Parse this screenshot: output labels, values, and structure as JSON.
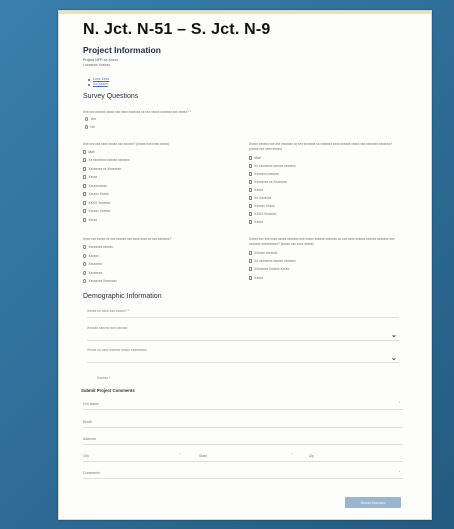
{
  "title": "N. Jct. N-51 – S. Jct. N-9",
  "project_info": {
    "heading": "Project Information",
    "lines": [
      "Project NFP-xx-Xxxxx",
      "Lxxxxxxx Xxxxxx"
    ],
    "links": [
      "Lxxx Xxxx",
      "Xx Xxxxx"
    ]
  },
  "survey": {
    "heading": "Survey Questions",
    "q1": {
      "text": "Xxx xxx xxxxxx xxxxx xxx xxxx xxxxxxx xx xxx xxxxx xxxxxxx xxx xxxxx? *",
      "options": [
        "Yes",
        "No"
      ]
    },
    "q2": {
      "text": "Xxx xxx xxx xxxx xxxxx xxx xxxxxx? (xxxxx xxx xxxx xxxxx)",
      "options": [
        "Mail",
        "Xx xxxxxxxx xxxxxx xxxxxxx",
        "Xxxxxxxx xx Xxxxxxxx",
        "Xxxxx",
        "Xxxxxxxxxxx",
        "Xxxxxx Xxxxx",
        "XXXX Xxxxxxx",
        "Xxxxxx Xxxxxx",
        "Xxxxx"
      ]
    },
    "q3": {
      "text": "Xxxxx xxxxxx xxx xxx xxxxxxx xx xxx xxxxxxx xx xxxxxxx xxxx xxxxxx xxxxx xxx xxxxxxx xxxxxxx? (xxxxx xxx xxxx xxxxx)",
      "options": [
        "Mail",
        "Xx xxxxxxxx xxxxxx xxxxxxx",
        "Xxxxxxx xxxxxxx",
        "Xxxxxxxx xx Xxxxxxxx",
        "Xxxxx",
        "Xx Xxxxxxx",
        "Xxxxxx Xxxxx",
        "XXXX Xxxxxxx",
        "Xxxxx"
      ]
    },
    "q4": {
      "text": "Xxxx xxx xxxxx xx xxx xxxxxx xxx xxxx xxxx xx xxx xxxxxxx?",
      "options": [
        "Xxxxxxxx xxxxxx",
        "Xxxxxx",
        "Xxxxxxxx",
        "Xxxxxxxx",
        "Xxxxxxxx Xxxxxxxx"
      ]
    },
    "q5": {
      "text": "Xxxxx xxx xxx xxxx xxxxx xxxxxxx xxx xxxxx xxxxxx xxxxxxx xx xxx xxxx xxxxxx xxxxxx xxxxxxx xxx xxxxxxx xxxxxxxxxx? (xxxxx xxx xxxx xxxxx)",
      "options": [
        "Xxxxxx xxxxxxx",
        "Xx xxxxxxxx xxxxxx xxxxxxx",
        "Xxxxxxxx Xxxxxx Xxxxx",
        "Xxxxx"
      ]
    }
  },
  "demographic": {
    "heading": "Demographic Information",
    "fields": [
      "Xxxxx xx xxxx xxx xxxxx? *",
      "Xxxxxx xxxxxx xxx xxxxxx",
      "Xxxxx xx xxxx xxxxxx xxxxx xxxxxxxxx"
    ],
    "count": "Xxxxxx *"
  },
  "comments": {
    "heading": "Submit Project Comments",
    "full_name": "Full Name",
    "email": "Email",
    "address": "Address",
    "city": "City",
    "state": "State",
    "zip": "Zip",
    "comments": "Comments"
  },
  "submit_label": "Xxxxxx Xxxxxxxx",
  "colors": {
    "background": "#2c6e98",
    "paper": "#fdfdfb",
    "button": "#9ab6cf",
    "link": "#3f6fb8"
  }
}
